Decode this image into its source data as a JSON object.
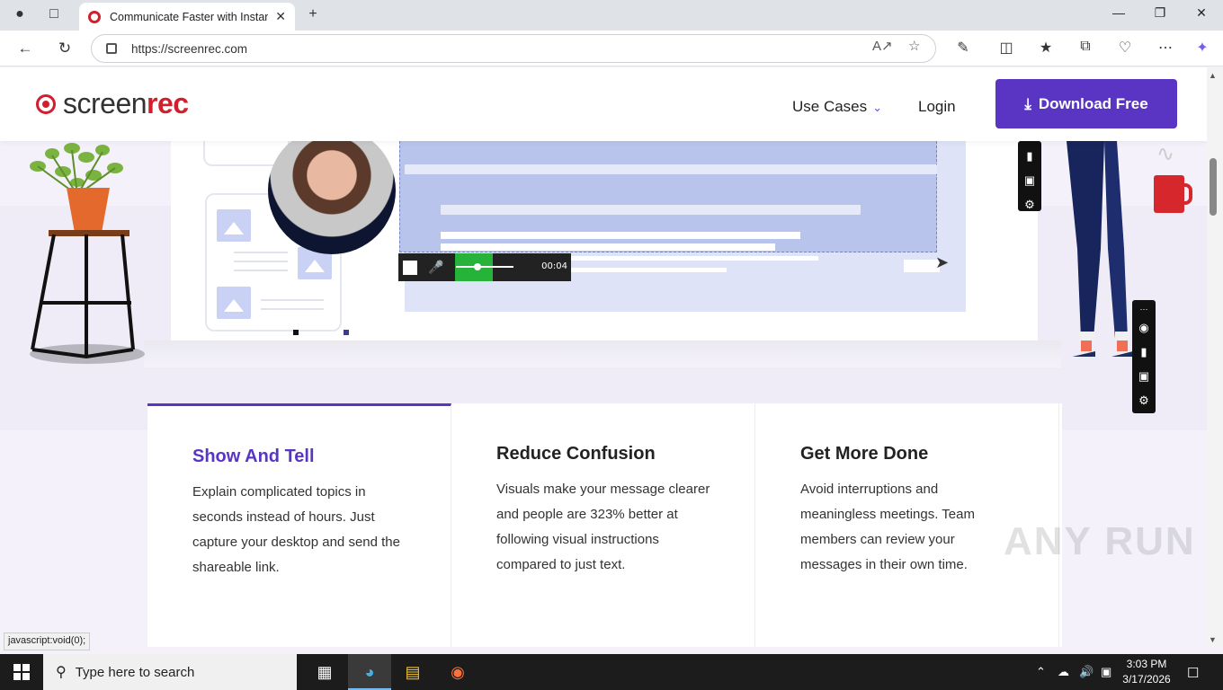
{
  "browser": {
    "tab_title": "Communicate Faster with Instant",
    "url": "https://screenrec.com"
  },
  "site": {
    "logo_part1": "screen",
    "logo_part2": "rec",
    "nav": {
      "use_cases": "Use Cases",
      "login": "Login",
      "download": "Download Free"
    }
  },
  "recorder": {
    "timer": "00:04"
  },
  "features": [
    {
      "title": "Show And Tell",
      "text": "Explain complicated topics in seconds instead of hours. Just capture your desktop and send the shareable link."
    },
    {
      "title": "Reduce Confusion",
      "text": "Visuals make your message clearer and people are 323% better at following visual instructions compared to just text."
    },
    {
      "title": "Get More Done",
      "text": "Avoid interruptions and meaningless meetings. Team members can review your messages in their own time."
    }
  ],
  "status_bar": "javascript:void(0);",
  "watermark": "ANY RUN",
  "taskbar": {
    "search_placeholder": "Type here to search",
    "time": "3:03 PM",
    "date": "3/17/2026"
  },
  "colors": {
    "brand_purple": "#5a35c4",
    "brand_red": "#d21f2d",
    "record_green": "#27b33a"
  }
}
